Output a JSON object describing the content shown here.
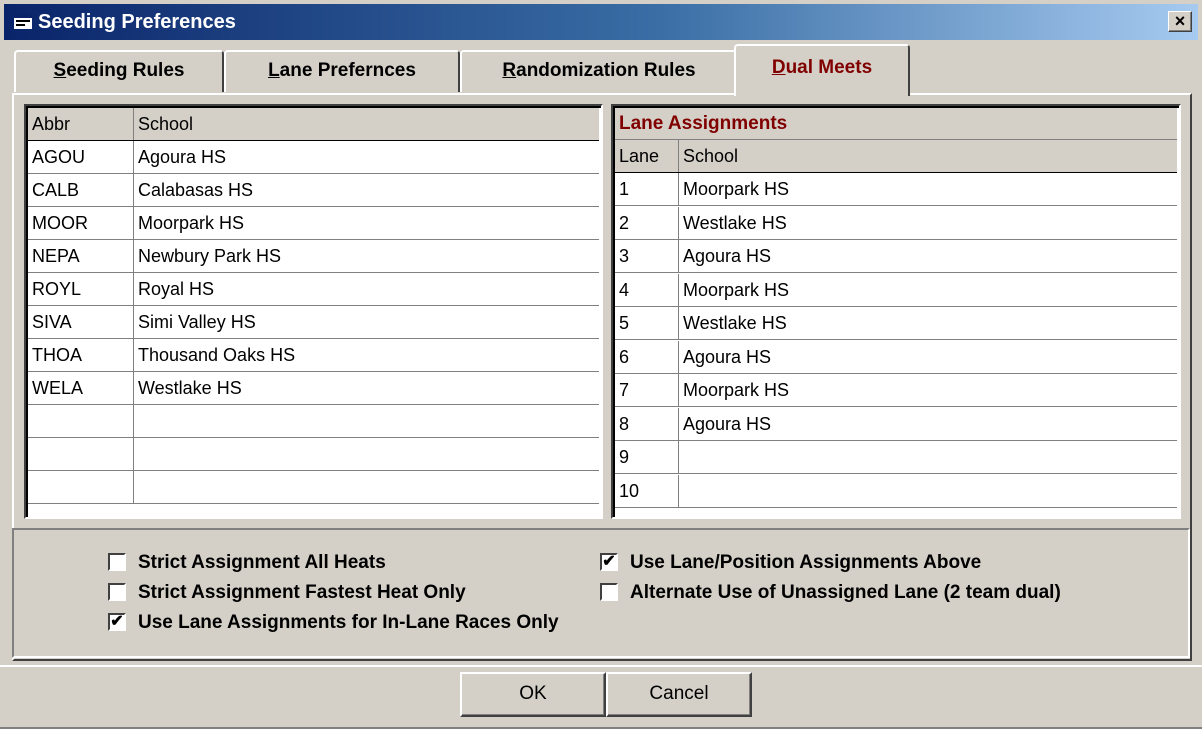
{
  "window": {
    "title": "Seeding Preferences",
    "close_label": "×"
  },
  "tabs": [
    {
      "label": "Seeding Rules",
      "accel": "S",
      "rest": "eeding Rules"
    },
    {
      "label": "Lane Prefernces",
      "accel": "L",
      "rest": "ane Prefernces"
    },
    {
      "label": "Randomization Rules",
      "accel": "R",
      "rest": "andomization Rules"
    },
    {
      "label": "Dual Meets",
      "accel": "D",
      "rest": "ual Meets",
      "active": true
    }
  ],
  "schools_grid": {
    "headers": {
      "abbr": "Abbr",
      "school": "School"
    },
    "rows": [
      {
        "abbr": "AGOU",
        "school": "Agoura HS"
      },
      {
        "abbr": "CALB",
        "school": "Calabasas HS"
      },
      {
        "abbr": "MOOR",
        "school": "Moorpark HS"
      },
      {
        "abbr": "NEPA",
        "school": "Newbury Park HS"
      },
      {
        "abbr": "ROYL",
        "school": "Royal HS"
      },
      {
        "abbr": "SIVA",
        "school": "Simi Valley HS"
      },
      {
        "abbr": "THOA",
        "school": "Thousand Oaks HS"
      },
      {
        "abbr": "WELA",
        "school": "Westlake HS"
      },
      {
        "abbr": "",
        "school": ""
      },
      {
        "abbr": "",
        "school": ""
      },
      {
        "abbr": "",
        "school": ""
      }
    ]
  },
  "lane_grid": {
    "title": "Lane Assignments",
    "headers": {
      "lane": "Lane",
      "school": "School"
    },
    "rows": [
      {
        "lane": "1",
        "school": "Moorpark HS"
      },
      {
        "lane": "2",
        "school": "Westlake HS"
      },
      {
        "lane": "3",
        "school": "Agoura HS"
      },
      {
        "lane": "4",
        "school": "Moorpark HS"
      },
      {
        "lane": "5",
        "school": "Westlake HS"
      },
      {
        "lane": "6",
        "school": "Agoura HS"
      },
      {
        "lane": "7",
        "school": "Moorpark HS"
      },
      {
        "lane": "8",
        "school": "Agoura HS"
      },
      {
        "lane": "9",
        "school": ""
      },
      {
        "lane": "10",
        "school": ""
      }
    ]
  },
  "options": {
    "strict_all_heats": {
      "label": "Strict Assignment All Heats",
      "checked": false
    },
    "strict_fastest": {
      "label": "Strict Assignment Fastest Heat Only",
      "checked": false
    },
    "in_lane_only": {
      "label": "Use Lane Assignments for In-Lane Races Only",
      "checked": true
    },
    "use_above": {
      "label": "Use Lane/Position Assignments Above",
      "checked": true
    },
    "alternate": {
      "label": "Alternate Use of Unassigned Lane (2 team dual)",
      "checked": false
    }
  },
  "buttons": {
    "ok": "OK",
    "cancel": "Cancel"
  },
  "check_glyph": "✔"
}
